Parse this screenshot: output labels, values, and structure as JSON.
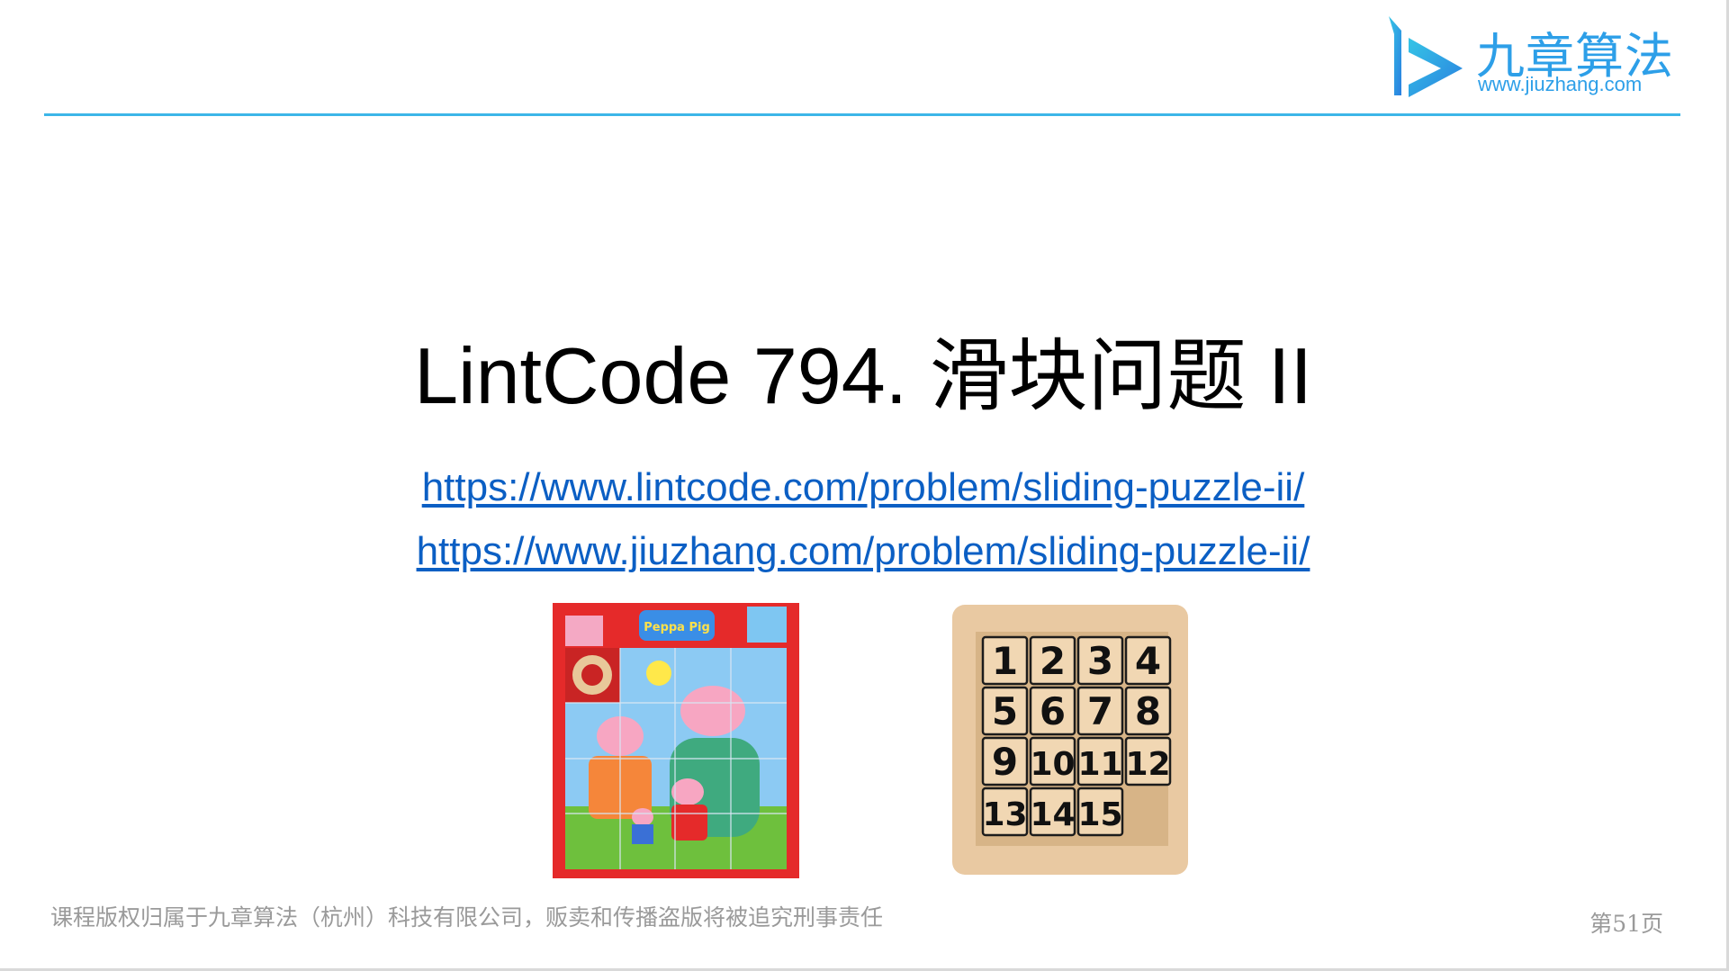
{
  "logo": {
    "name_cn": "九章算法",
    "url": "www.jiuzhang.com"
  },
  "title": "LintCode 794. 滑块问题 II",
  "links": [
    "https://www.lintcode.com/problem/sliding-puzzle-ii/",
    "https://www.jiuzhang.com/problem/sliding-puzzle-ii/"
  ],
  "images": {
    "peppa_puzzle": {
      "brand_label": "Peppa Pig"
    },
    "number_puzzle": {
      "tiles": [
        "1",
        "2",
        "3",
        "4",
        "5",
        "6",
        "7",
        "8",
        "9",
        "10",
        "11",
        "12",
        "13",
        "14",
        "15"
      ]
    }
  },
  "footer": {
    "copyright": "课程版权归属于九章算法（杭州）科技有限公司，贩卖和传播盗版将被追究刑事责任",
    "page": "第51页"
  },
  "colors": {
    "accent": "#3cb6e8",
    "logo": "#2d9fe8",
    "link": "#0b5fc4"
  }
}
